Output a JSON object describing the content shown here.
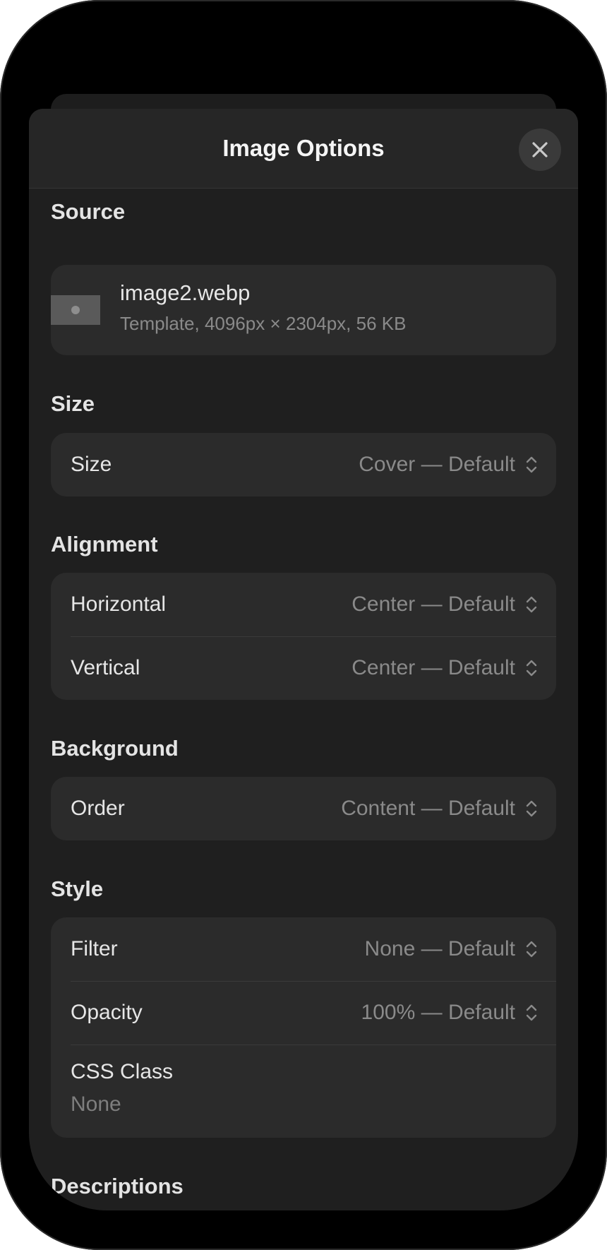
{
  "sheet": {
    "title": "Image Options",
    "close_icon": "close-icon"
  },
  "source": {
    "title": "Source",
    "file_name": "image2.webp",
    "file_meta": "Template, 4096px × 2304px, 56 KB",
    "thumbnail_icon": "image-thumbnail"
  },
  "size": {
    "title": "Size",
    "rows": [
      {
        "label": "Size",
        "value": "Cover — Default"
      }
    ]
  },
  "alignment": {
    "title": "Alignment",
    "rows": [
      {
        "label": "Horizontal",
        "value": "Center — Default"
      },
      {
        "label": "Vertical",
        "value": "Center — Default"
      }
    ]
  },
  "background": {
    "title": "Background",
    "rows": [
      {
        "label": "Order",
        "value": "Content — Default"
      }
    ]
  },
  "style": {
    "title": "Style",
    "rows": [
      {
        "label": "Filter",
        "value": "None — Default"
      },
      {
        "label": "Opacity",
        "value": "100% — Default"
      }
    ],
    "css_class": {
      "label": "CSS Class",
      "value": "None"
    }
  },
  "descriptions": {
    "title": "Descriptions"
  },
  "colors": {
    "device_bg": "#000000",
    "sheet_bg": "#1f1f1f",
    "group_bg": "#2b2b2b",
    "primary_text": "#e6e6e6",
    "secondary_text": "#8a8a8a"
  }
}
